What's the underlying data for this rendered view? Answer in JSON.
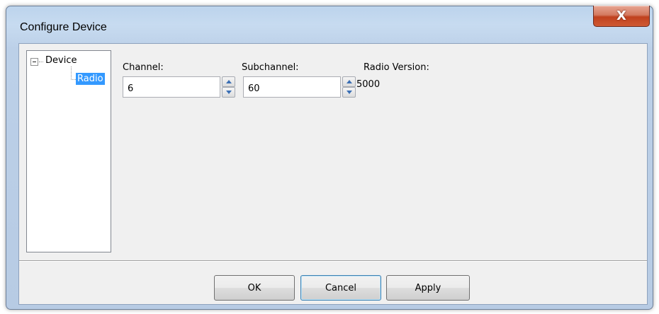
{
  "window": {
    "title": "Configure Device",
    "close_glyph": "X"
  },
  "tree": {
    "root_label": "Device",
    "child_label": "Radio",
    "expander_icon": "collapse-minus-icon"
  },
  "fields": {
    "channel": {
      "label": "Channel:",
      "value": "6"
    },
    "subchannel": {
      "label": "Subchannel:",
      "value": "60"
    },
    "radio_version": {
      "label": "Radio Version:",
      "value": "5000"
    }
  },
  "buttons": {
    "ok": "OK",
    "cancel": "Cancel",
    "apply": "Apply"
  },
  "colors": {
    "selection": "#3399ff",
    "close_button": "#c7502b",
    "spin_arrow": "#3b6fb4"
  }
}
